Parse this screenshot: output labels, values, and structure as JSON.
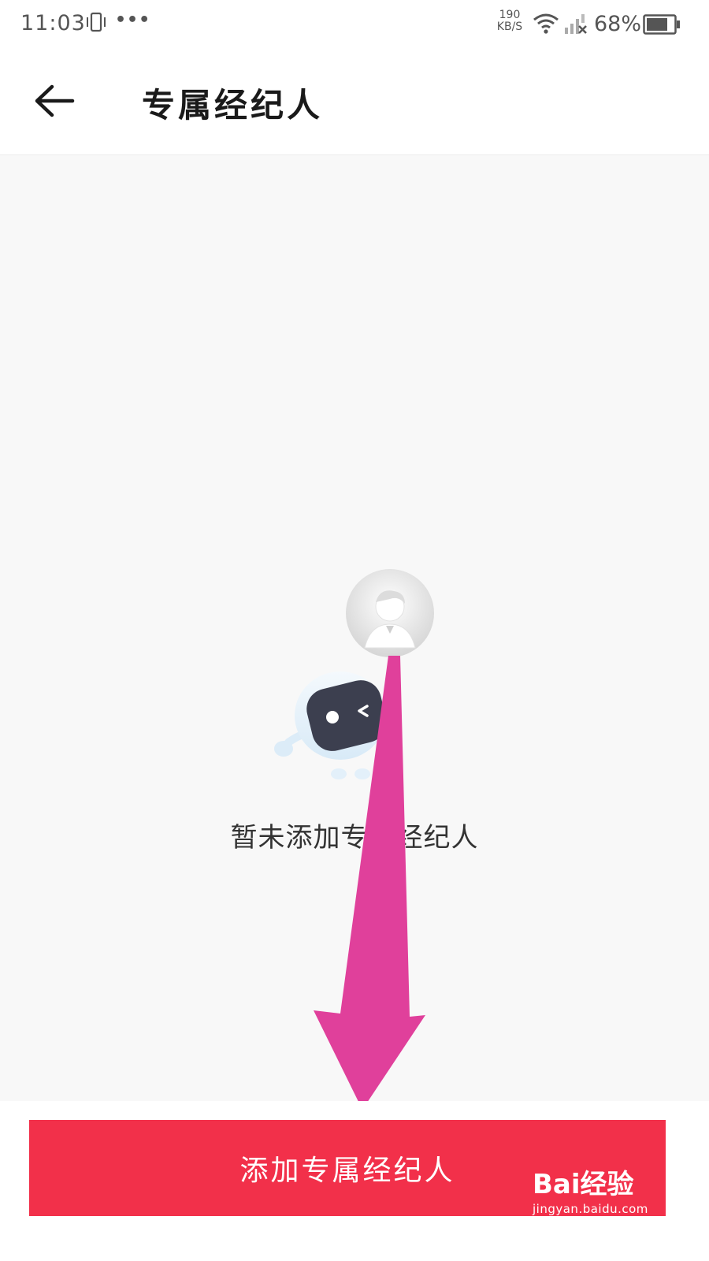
{
  "status_bar": {
    "time": "11:03",
    "net_speed_value": "190",
    "net_speed_unit": "KB/S",
    "battery": "68%",
    "icons": [
      "vibrate-icon",
      "more-dots-icon",
      "wifi-icon",
      "signal-x-icon",
      "battery-icon"
    ]
  },
  "header": {
    "title": "专属经纪人",
    "back_icon": "arrow-left-icon"
  },
  "empty_state": {
    "illustration": "robot-with-agent-avatar",
    "message": "暂未添加专属经纪人"
  },
  "footer": {
    "add_button_label": "添加专属经纪人"
  },
  "watermark": {
    "logo": "Bai经验",
    "url": "jingyan.baidu.com"
  },
  "colors": {
    "accent": "#f2304a",
    "annotation_arrow": "#e0409b",
    "page_background": "#f8f8f8"
  }
}
